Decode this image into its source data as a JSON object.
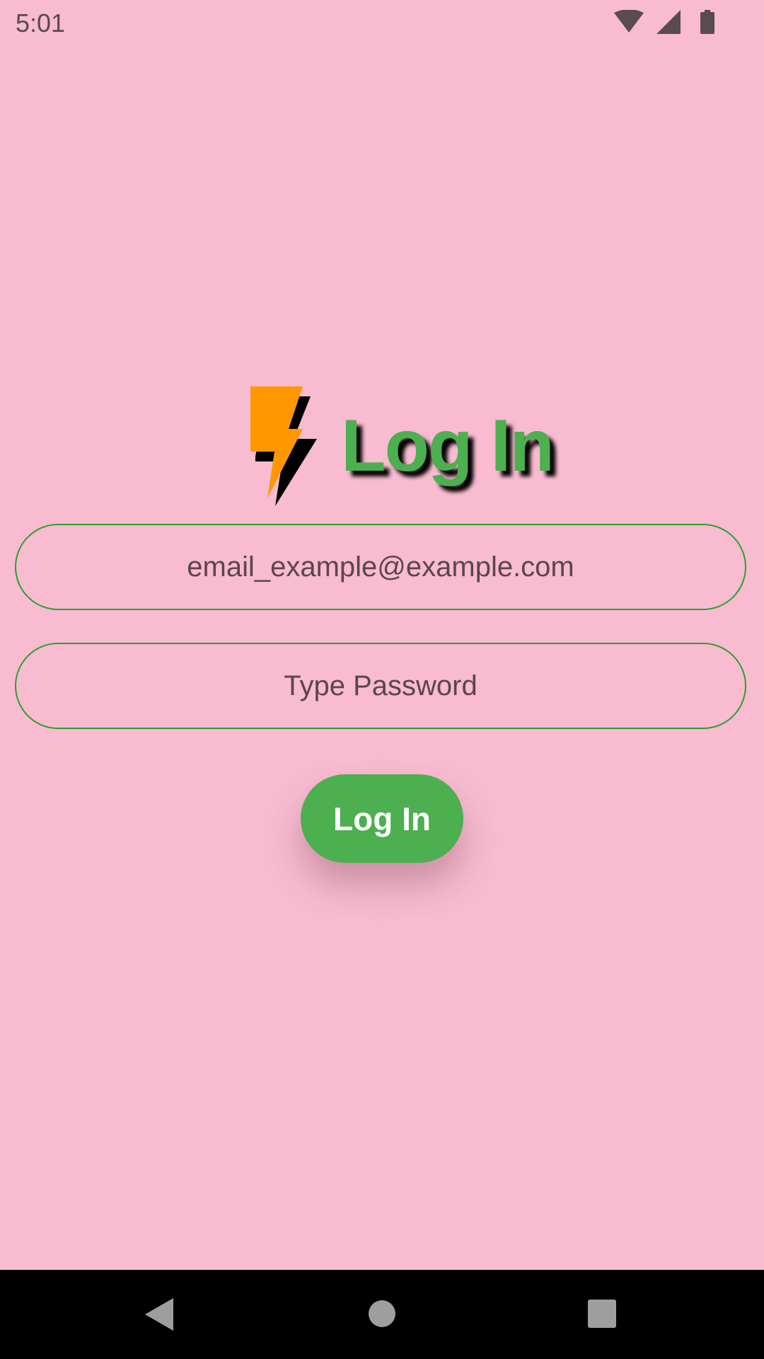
{
  "status_bar": {
    "time": "5:01",
    "icons": [
      "wifi-icon",
      "cellular-signal-icon",
      "battery-icon"
    ]
  },
  "header": {
    "icon": "lightning-bolt-icon",
    "title": "Log In"
  },
  "form": {
    "email_placeholder": "email_example@example.com",
    "password_placeholder": "Type Password",
    "submit_label": "Log In"
  },
  "nav_bar": {
    "icons": [
      "back-icon",
      "home-icon",
      "recents-icon"
    ]
  },
  "colors": {
    "background": "#F8BBD0",
    "accent_green": "#4CAF50",
    "field_border": "#2E9E2E",
    "bolt_orange": "#FF9800",
    "placeholder_text": "#5b4550"
  }
}
